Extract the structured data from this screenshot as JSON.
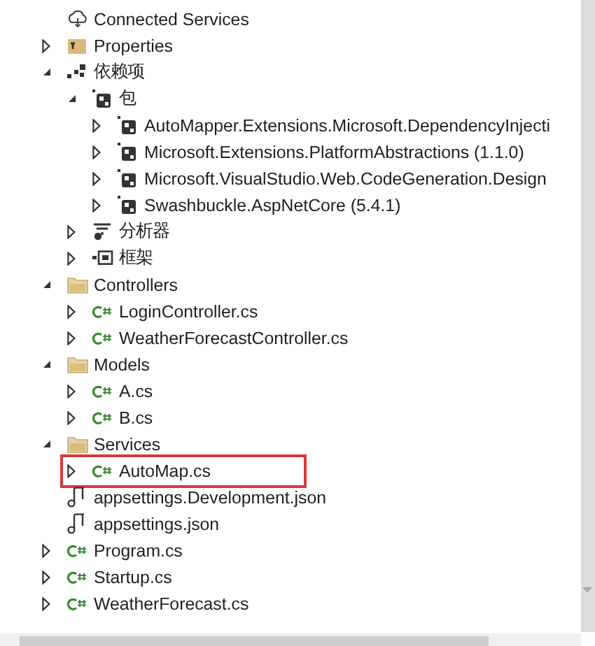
{
  "tree": [
    {
      "label": "Connected Services",
      "kind": "cloud"
    },
    {
      "label": "Properties",
      "kind": "properties",
      "expanded": false
    },
    {
      "label": "依赖项",
      "kind": "dependencies",
      "expanded": true,
      "children": [
        {
          "label": "包",
          "kind": "package",
          "expanded": true,
          "children": [
            {
              "label": "AutoMapper.Extensions.Microsoft.DependencyInjecti",
              "kind": "package",
              "expanded": false
            },
            {
              "label": "Microsoft.Extensions.PlatformAbstractions (1.1.0)",
              "kind": "package",
              "expanded": false
            },
            {
              "label": "Microsoft.VisualStudio.Web.CodeGeneration.Design",
              "kind": "package",
              "expanded": false
            },
            {
              "label": "Swashbuckle.AspNetCore (5.4.1)",
              "kind": "package",
              "expanded": false
            }
          ]
        },
        {
          "label": "分析器",
          "kind": "analyzer",
          "expanded": false
        },
        {
          "label": "框架",
          "kind": "framework",
          "expanded": false
        }
      ]
    },
    {
      "label": "Controllers",
      "kind": "folder",
      "expanded": true,
      "children": [
        {
          "label": "LoginController.cs",
          "kind": "csharp",
          "expanded": false
        },
        {
          "label": "WeatherForecastController.cs",
          "kind": "csharp",
          "expanded": false
        }
      ]
    },
    {
      "label": "Models",
      "kind": "folder",
      "expanded": true,
      "children": [
        {
          "label": "A.cs",
          "kind": "csharp",
          "expanded": false
        },
        {
          "label": "B.cs",
          "kind": "csharp",
          "expanded": false
        }
      ]
    },
    {
      "label": "Services",
      "kind": "folder",
      "expanded": true,
      "children": [
        {
          "label": "AutoMap.cs",
          "kind": "csharp",
          "expanded": false,
          "highlighted": true
        }
      ]
    },
    {
      "label": "appsettings.Development.json",
      "kind": "json"
    },
    {
      "label": "appsettings.json",
      "kind": "json"
    },
    {
      "label": "Program.cs",
      "kind": "csharp",
      "expanded": false
    },
    {
      "label": "Startup.cs",
      "kind": "csharp",
      "expanded": false
    },
    {
      "label": "WeatherForecast.cs",
      "kind": "csharp",
      "expanded": false
    }
  ]
}
